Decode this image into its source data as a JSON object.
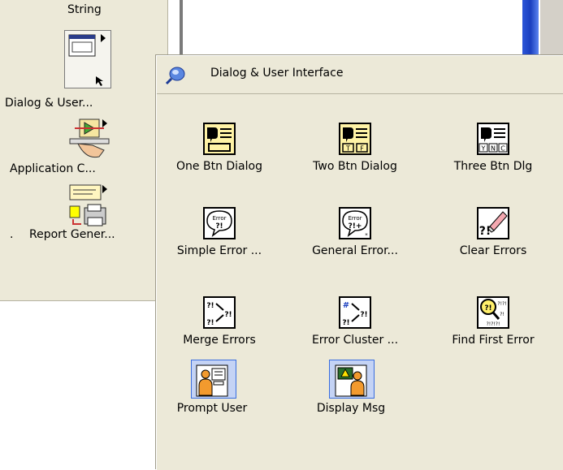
{
  "back_palette": {
    "items": [
      {
        "label": "String"
      },
      {
        "label": "Dialog & User..."
      },
      {
        "label": "Application C..."
      },
      {
        "label": "Report Gener..."
      }
    ],
    "left_dot": "."
  },
  "palette": {
    "title": "Dialog & User Interface",
    "items": [
      {
        "label": "One Btn Dialog",
        "icon": "one-button-dialog-icon"
      },
      {
        "label": "Two Btn Dialog",
        "icon": "two-button-dialog-icon"
      },
      {
        "label": "Three Btn Dlg",
        "icon": "three-button-dialog-icon"
      },
      {
        "label": "Simple Error ...",
        "icon": "simple-error-icon"
      },
      {
        "label": "General Error...",
        "icon": "general-error-icon"
      },
      {
        "label": "Clear Errors",
        "icon": "clear-errors-icon"
      },
      {
        "label": "Merge Errors",
        "icon": "merge-errors-icon"
      },
      {
        "label": "Error Cluster ...",
        "icon": "error-cluster-icon"
      },
      {
        "label": "Find First Error",
        "icon": "find-first-error-icon"
      },
      {
        "label": "Prompt User",
        "icon": "prompt-user-icon"
      },
      {
        "label": "Display Msg",
        "icon": "display-message-icon"
      }
    ],
    "icon_text": {
      "tf": "T F",
      "ync": "Y N C",
      "error": "Error",
      "qe": "?!",
      "qe_plus": "?!+"
    }
  },
  "colors": {
    "palette_bg": "#ece9d8",
    "selection": "#c4d3f5",
    "selection_border": "#3a6ee0"
  }
}
